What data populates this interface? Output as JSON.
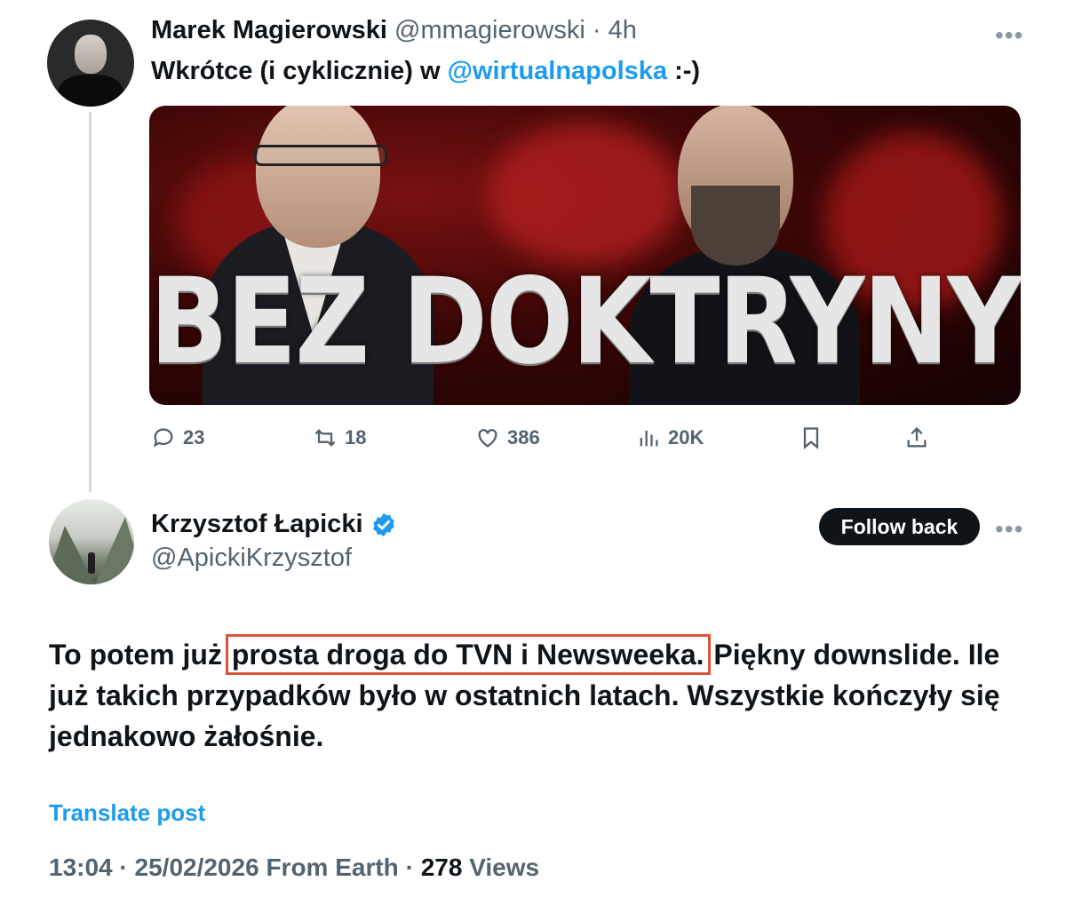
{
  "quoted_tweet": {
    "author_name": "Marek Magierowski",
    "author_handle": "@mmagierowski",
    "separator": "·",
    "time": "4h",
    "text_before": "Wkrótce (i cyklicznie) w ",
    "mention": "@wirtualnapolska",
    "text_after": " :-)",
    "media_title": "BEZ DOKTRYNY",
    "actions": {
      "replies": "23",
      "reposts": "18",
      "likes": "386",
      "views": "20K"
    }
  },
  "reply": {
    "author_name": "Krzysztof Łapicki",
    "author_handle": "@ApickiKrzysztof",
    "follow_label": "Follow back",
    "text_before": "To potem już ",
    "text_highlight": "prosta droga do TVN i Newsweeka.",
    "text_after": " Piękny downslide. Ile już takich przypadków było w ostatnich latach. Wszystkie kończyły się jednakowo żałośnie.",
    "translate_label": "Translate post",
    "meta_time": "13:04",
    "meta_date": "25/02/2026",
    "meta_source": "From Earth",
    "views_count": "278",
    "views_label": "Views"
  },
  "colors": {
    "link": "#1d9bf0",
    "secondary_text": "#536471",
    "highlight_box": "#d9543a",
    "verified_badge": "#1d9bf0"
  },
  "icons": [
    "more-icon",
    "reply-icon",
    "repost-icon",
    "like-icon",
    "views-icon",
    "bookmark-icon",
    "share-icon",
    "verified-badge-icon"
  ]
}
